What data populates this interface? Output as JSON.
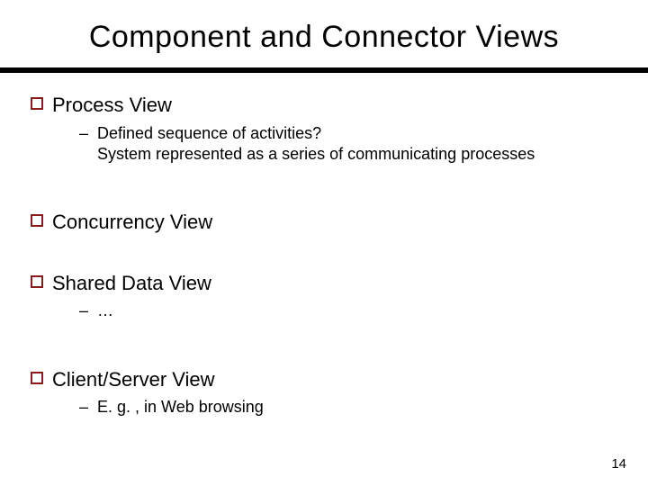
{
  "slide": {
    "title": "Component and Connector Views",
    "bullets": {
      "b1": {
        "label": "Process View",
        "sub": {
          "s1_line1": "Defined sequence of activities?",
          "s1_line2": "System represented as a series of communicating processes"
        }
      },
      "b2": {
        "label": "Concurrency View"
      },
      "b3": {
        "label": "Shared Data View",
        "sub": {
          "s1": "…"
        }
      },
      "b4": {
        "label": "Client/Server View",
        "sub": {
          "s1": "E. g. , in Web browsing"
        }
      }
    },
    "page_number": "14"
  },
  "colors": {
    "bullet_border": "#8b1a1a"
  }
}
